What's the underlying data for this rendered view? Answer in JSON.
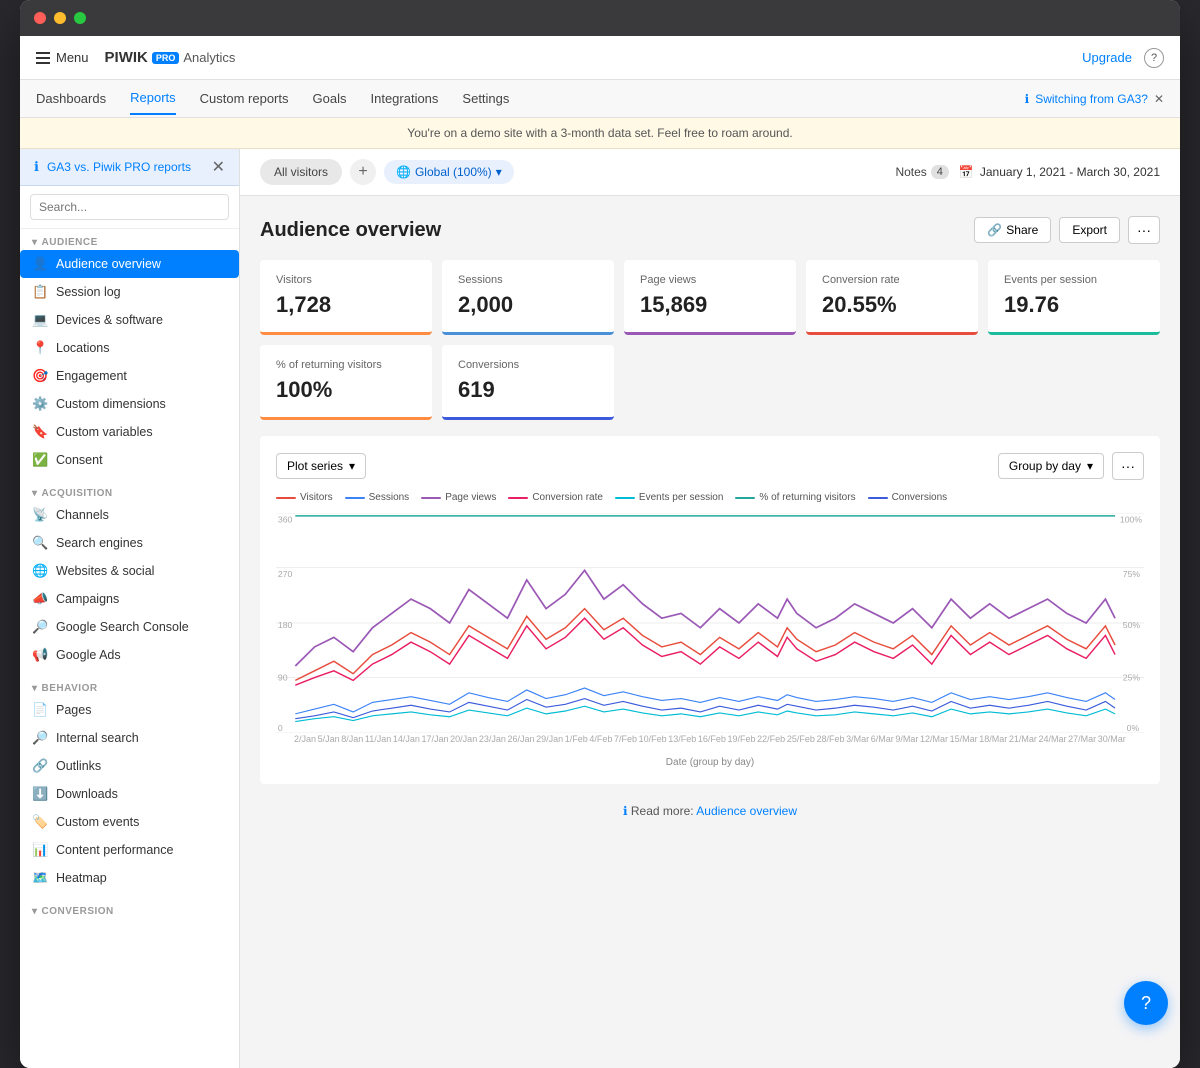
{
  "window": {
    "title": "Piwik PRO Analytics"
  },
  "topbar": {
    "menu_label": "Menu",
    "logo": "PIWIK",
    "logo_pro": "PRO",
    "logo_analytics": "Analytics",
    "upgrade": "Upgrade"
  },
  "nav": {
    "items": [
      "Dashboards",
      "Reports",
      "Custom reports",
      "Goals",
      "Integrations",
      "Settings"
    ],
    "active": "Reports"
  },
  "banner": "You're on a demo site with a 3-month data set. Feel free to roam around.",
  "switching_bar": {
    "text": "Switching from GA3?",
    "ga3_link": "GA3 vs. Piwik PRO reports"
  },
  "tabs": {
    "all_visitors": "All visitors",
    "segment": "Global (100%)"
  },
  "header": {
    "notes_label": "Notes",
    "notes_count": "4",
    "date_range": "January 1, 2021 - March 30, 2021"
  },
  "sidebar": {
    "search_placeholder": "Search...",
    "sections": [
      {
        "label": "AUDIENCE",
        "items": [
          {
            "icon": "👤",
            "label": "Audience overview",
            "active": true
          },
          {
            "icon": "📋",
            "label": "Session log"
          },
          {
            "icon": "💻",
            "label": "Devices & software"
          },
          {
            "icon": "📍",
            "label": "Locations"
          },
          {
            "icon": "🎯",
            "label": "Engagement"
          },
          {
            "icon": "⚙️",
            "label": "Custom dimensions"
          },
          {
            "icon": "🔖",
            "label": "Custom variables"
          },
          {
            "icon": "✅",
            "label": "Consent"
          }
        ]
      },
      {
        "label": "ACQUISITION",
        "items": [
          {
            "icon": "📡",
            "label": "Channels"
          },
          {
            "icon": "🔍",
            "label": "Search engines"
          },
          {
            "icon": "🌐",
            "label": "Websites & social"
          },
          {
            "icon": "📣",
            "label": "Campaigns"
          },
          {
            "icon": "🔎",
            "label": "Google Search Console"
          },
          {
            "icon": "📢",
            "label": "Google Ads"
          }
        ]
      },
      {
        "label": "BEHAVIOR",
        "items": [
          {
            "icon": "📄",
            "label": "Pages"
          },
          {
            "icon": "🔎",
            "label": "Internal search"
          },
          {
            "icon": "🔗",
            "label": "Outlinks"
          },
          {
            "icon": "⬇️",
            "label": "Downloads"
          },
          {
            "icon": "🏷️",
            "label": "Custom events"
          },
          {
            "icon": "📊",
            "label": "Content performance"
          },
          {
            "icon": "🗺️",
            "label": "Heatmap"
          }
        ]
      },
      {
        "label": "CONVERSION",
        "items": []
      }
    ]
  },
  "page": {
    "title": "Audience overview",
    "share_label": "Share",
    "export_label": "Export"
  },
  "metrics": [
    {
      "label": "Visitors",
      "value": "1,728",
      "color": "orange"
    },
    {
      "label": "Sessions",
      "value": "2,000",
      "color": "blue"
    },
    {
      "label": "Page views",
      "value": "15,869",
      "color": "purple"
    },
    {
      "label": "Conversion rate",
      "value": "20.55%",
      "color": "red"
    },
    {
      "label": "Events per session",
      "value": "19.76",
      "color": "teal"
    }
  ],
  "metrics2": [
    {
      "label": "% of returning visitors",
      "value": "100%",
      "color": "orange"
    },
    {
      "label": "Conversions",
      "value": "619",
      "color": "indigo"
    }
  ],
  "chart": {
    "plot_series": "Plot series",
    "group_by": "Group by day",
    "legend": [
      {
        "label": "Visitors",
        "color": "#e74c3c"
      },
      {
        "label": "Sessions",
        "color": "#3b82f6"
      },
      {
        "label": "Page views",
        "color": "#9b59b6"
      },
      {
        "label": "Conversion rate",
        "color": "#e91e63"
      },
      {
        "label": "Events per session",
        "color": "#00bcd4"
      },
      {
        "label": "% of returning visitors",
        "color": "#26a69a"
      },
      {
        "label": "Conversions",
        "color": "#3b5bdb"
      }
    ],
    "x_label": "Date (group by day)"
  },
  "read_more": {
    "text": "Read more:",
    "link_label": "Audience overview"
  },
  "fab": "?"
}
